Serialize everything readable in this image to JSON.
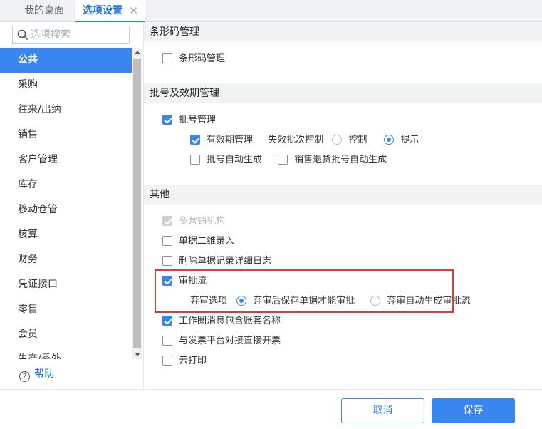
{
  "tabs": {
    "desktop": "我的桌面",
    "options": "选项设置",
    "close_glyph": "✕"
  },
  "search": {
    "placeholder": "选项搜索"
  },
  "nav": {
    "items": [
      "公共",
      "采购",
      "往来/出纳",
      "销售",
      "客户管理",
      "库存",
      "移动仓管",
      "核算",
      "财务",
      "凭证接口",
      "零售",
      "会员",
      "生产/委外"
    ],
    "active_index": 0,
    "help_label": "帮助"
  },
  "sections": {
    "barcode": {
      "title": "条形码管理",
      "barcode_mgmt": "条形码管理"
    },
    "batch": {
      "title": "批号及效期管理",
      "batch_mgmt": "批号管理",
      "expiry_mgmt": "有效期管理",
      "expired_control_label": "失效批次控制",
      "control": "控制",
      "prompt": "提示",
      "auto_batch": "批号自动生成",
      "return_auto_batch": "销售退货批号自动生成"
    },
    "other": {
      "title": "其他",
      "multi_org": "多营销机构",
      "qr_entry": "单据二维录入",
      "delete_log": "删除单据记录详细日志",
      "approval_flow": "审批流",
      "abandon_label": "弃审选项",
      "abandon_opt1": "弃审后保存单据才能审批",
      "abandon_opt2": "弃审自动生成审批流",
      "workcircle": "工作圈消息包含账套名称",
      "invoice": "与发票平台对接直接开票",
      "cloud_print": "云打印"
    }
  },
  "footer": {
    "cancel": "取消",
    "save": "保存"
  },
  "colors": {
    "accent": "#3a86f0",
    "highlight_box": "#e53935"
  }
}
